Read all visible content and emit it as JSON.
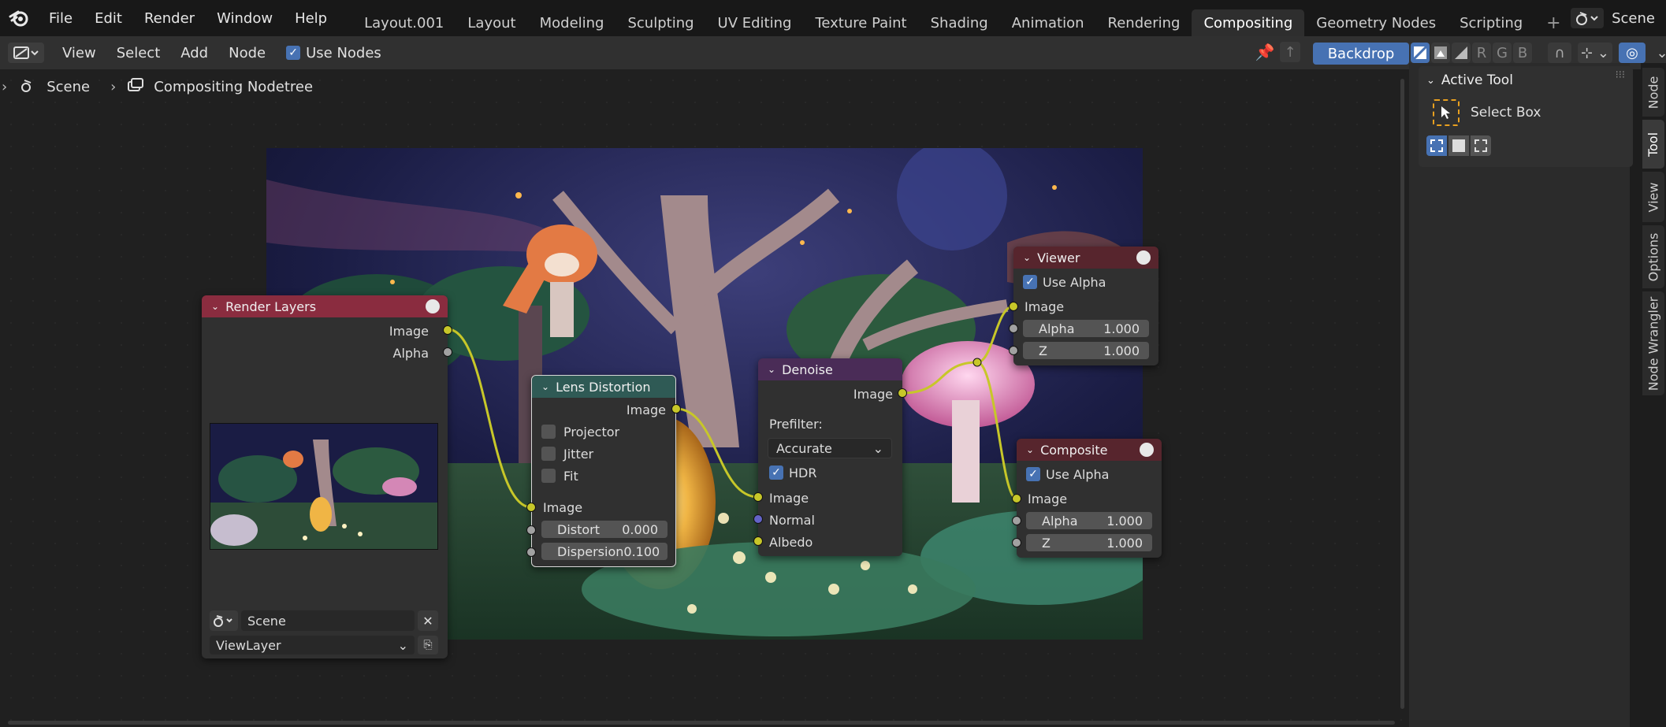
{
  "menu": [
    "File",
    "Edit",
    "Render",
    "Window",
    "Help"
  ],
  "workspaces": [
    "Layout.001",
    "Layout",
    "Modeling",
    "Sculpting",
    "UV Editing",
    "Texture Paint",
    "Shading",
    "Animation",
    "Rendering",
    "Compositing",
    "Geometry Nodes",
    "Scripting"
  ],
  "active_workspace": "Compositing",
  "add_workspace": "+",
  "scene_name": "Scene",
  "header": {
    "view": "View",
    "select": "Select",
    "add": "Add",
    "node": "Node",
    "use_nodes": "Use Nodes",
    "backdrop": "Backdrop",
    "channels": [
      "R",
      "G",
      "B"
    ]
  },
  "breadcrumb": {
    "scene": "Scene",
    "tree": "Compositing Nodetree"
  },
  "sidebar": {
    "panel_title": "Active Tool",
    "tool_name": "Select Box",
    "tabs": [
      "Node",
      "Tool",
      "View",
      "Options",
      "Node Wrangler"
    ],
    "active_tab": "Tool"
  },
  "nodes": {
    "render_layers": {
      "title": "Render Layers",
      "out_image": "Image",
      "out_alpha": "Alpha",
      "scene": "Scene",
      "view_layer": "ViewLayer"
    },
    "lens_distortion": {
      "title": "Lens Distortion",
      "out_image": "Image",
      "projector": "Projector",
      "jitter": "Jitter",
      "fit": "Fit",
      "in_image": "Image",
      "distort_label": "Distort",
      "distort_value": "0.000",
      "dispersion_label": "Dispersion",
      "dispersion_value": "0.100"
    },
    "denoise": {
      "title": "Denoise",
      "out_image": "Image",
      "prefilter_label": "Prefilter:",
      "prefilter_value": "Accurate",
      "hdr": "HDR",
      "in_image": "Image",
      "in_normal": "Normal",
      "in_albedo": "Albedo"
    },
    "viewer": {
      "title": "Viewer",
      "use_alpha": "Use Alpha",
      "in_image": "Image",
      "alpha_label": "Alpha",
      "alpha_value": "1.000",
      "z_label": "Z",
      "z_value": "1.000"
    },
    "composite": {
      "title": "Composite",
      "use_alpha": "Use Alpha",
      "in_image": "Image",
      "alpha_label": "Alpha",
      "alpha_value": "1.000",
      "z_label": "Z",
      "z_value": "1.000"
    }
  },
  "colors": {
    "input_header": "#8a2c3f",
    "distort_header": "#2f5a55",
    "filter_header": "#4a2c57",
    "output_header": "#57252d",
    "accent": "#4772b3",
    "socket_color": "#c7c729"
  }
}
